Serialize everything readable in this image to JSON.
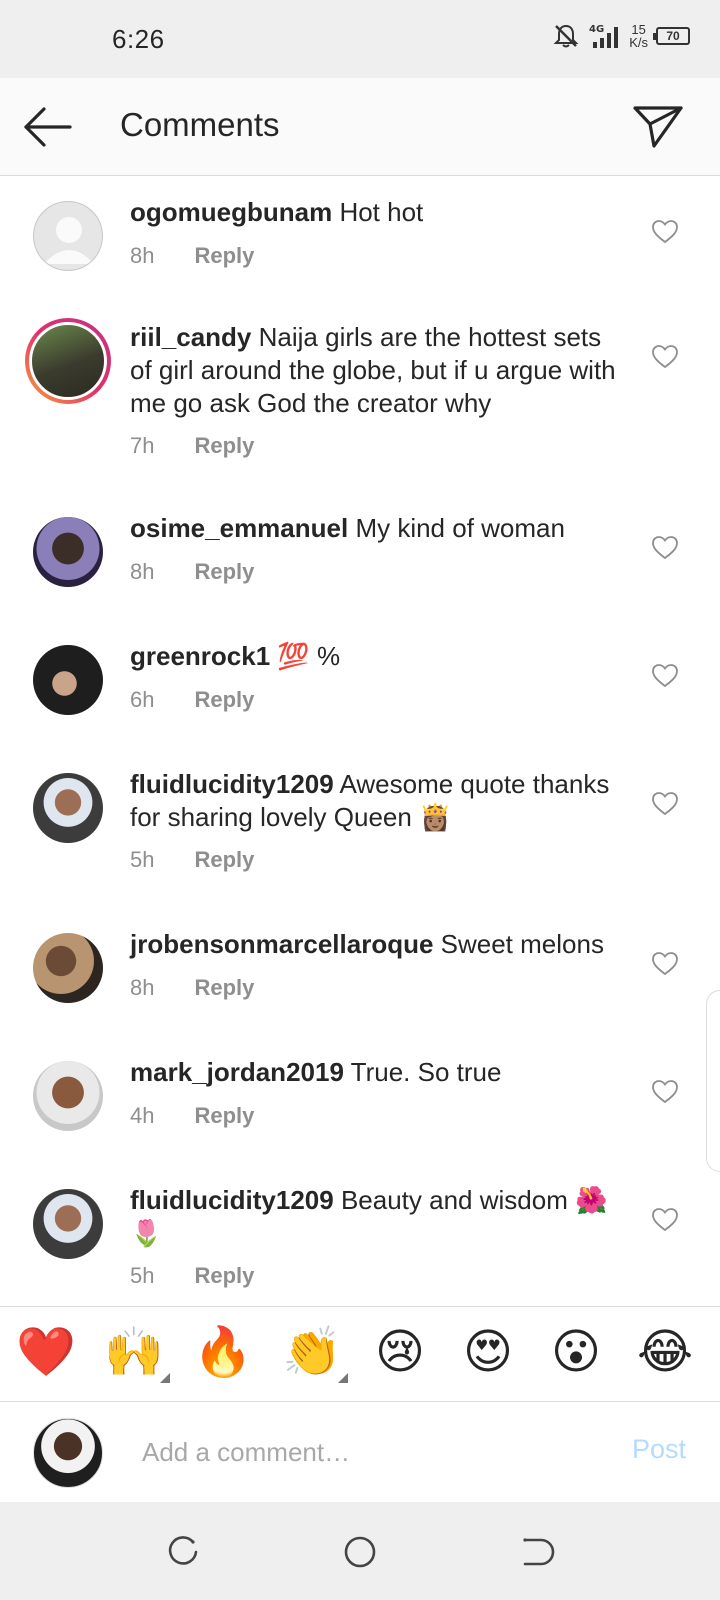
{
  "status_bar": {
    "time": "6:26",
    "network": "4G",
    "speed_value": "15",
    "speed_unit": "K/s",
    "battery": "70"
  },
  "header": {
    "title": "Comments"
  },
  "comments": [
    {
      "user": "ogomuegbunam",
      "text": " Hot hot",
      "time": "8h",
      "reply": "Reply"
    },
    {
      "user": "riil_candy",
      "text": " Naija girls are the hottest sets of girl around the globe, but if u argue with me go ask God the creator why",
      "time": "7h",
      "reply": "Reply"
    },
    {
      "user": "osime_emmanuel",
      "text": " My kind of woman",
      "time": "8h",
      "reply": "Reply"
    },
    {
      "user": "greenrock1",
      "text": " 💯 %",
      "time": "6h",
      "reply": "Reply"
    },
    {
      "user": "fluidlucidity1209",
      "text": " Awesome quote thanks for sharing lovely Queen 👸🏽",
      "time": "5h",
      "reply": "Reply"
    },
    {
      "user": "jrobensonmarcellaroque",
      "text": " Sweet melons",
      "time": "8h",
      "reply": "Reply"
    },
    {
      "user": "mark_jordan2019",
      "text": " True. So true",
      "time": "4h",
      "reply": "Reply"
    },
    {
      "user": "fluidlucidity1209",
      "text": " Beauty and wisdom 🌺🌷",
      "time": "5h",
      "reply": "Reply"
    }
  ],
  "emoji_bar": [
    "❤️",
    "🙌",
    "🔥",
    "👏",
    "😢",
    "😍",
    "😮",
    "😂"
  ],
  "composer": {
    "placeholder": "Add a comment…",
    "post_label": "Post"
  },
  "colors": {
    "link_disabled": "#b3dbff",
    "meta_gray": "#8e8e8e",
    "divider": "#dbdbdb"
  }
}
